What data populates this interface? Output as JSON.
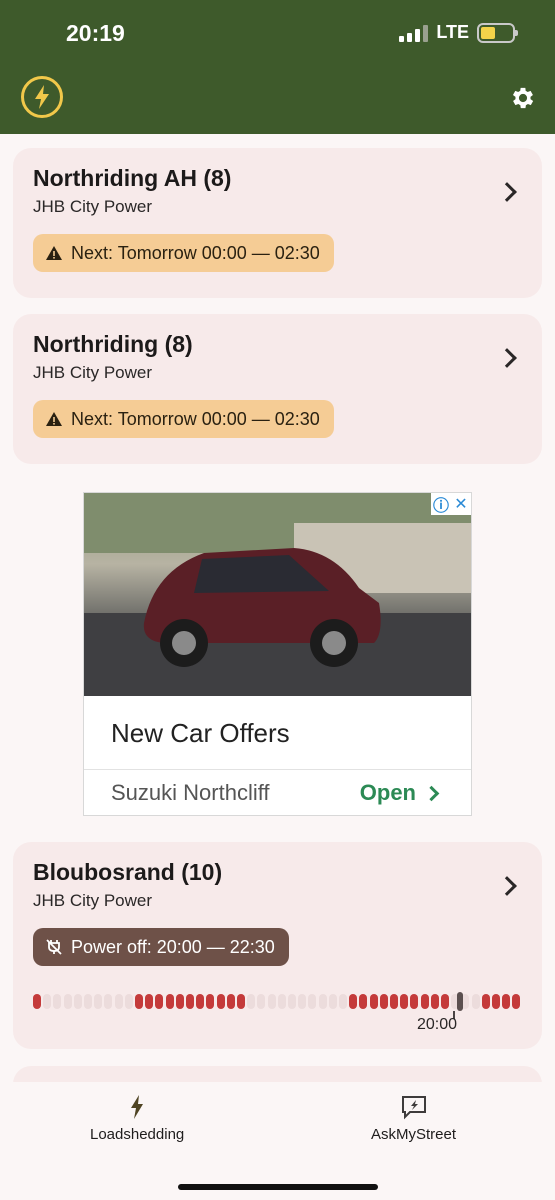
{
  "status_bar": {
    "time": "20:19",
    "network": "LTE",
    "battery_color": "#f3d34a"
  },
  "header": {
    "logo_icon": "lightning-icon",
    "settings_icon": "gear-icon",
    "bg_color": "#3e5a2b"
  },
  "areas": [
    {
      "name": "Northriding AH (8)",
      "provider": "JHB City Power",
      "badge_type": "next",
      "badge_text": "Next: Tomorrow 00:00 — 02:30"
    },
    {
      "name": "Northriding (8)",
      "provider": "JHB City Power",
      "badge_type": "next",
      "badge_text": "Next: Tomorrow 00:00 — 02:30"
    },
    {
      "name": "Bloubosrand (10)",
      "provider": "JHB City Power",
      "badge_type": "off",
      "badge_text": "Power off: 20:00 — 22:30",
      "timeline_label": "20:00"
    }
  ],
  "ad": {
    "headline": "New Car Offers",
    "advertiser": "Suzuki Northcliff",
    "cta": "Open"
  },
  "nav": {
    "items": [
      {
        "label": "Loadshedding",
        "icon": "lightning-icon"
      },
      {
        "label": "AskMyStreet",
        "icon": "chat-lightning-icon"
      }
    ]
  }
}
